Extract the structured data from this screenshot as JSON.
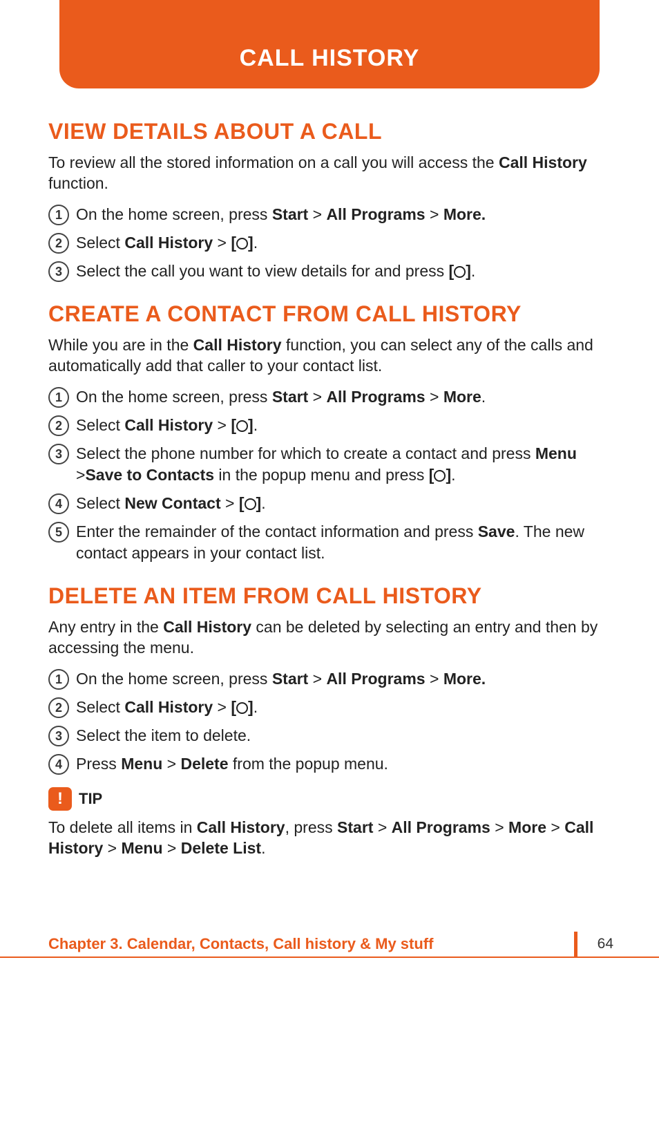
{
  "header": {
    "title": "CALL HISTORY"
  },
  "sections": {
    "view": {
      "heading": "VIEW DETAILS ABOUT A CALL",
      "intro_pre": "To review all the stored information on a call you will access the ",
      "intro_bold": "Call History",
      "intro_post": " function.",
      "s1_a": "On the home screen, press ",
      "s1_b": "Start",
      "s1_c": " > ",
      "s1_d": "All Programs",
      "s1_e": " > ",
      "s1_f": "More.",
      "s2_a": "Select ",
      "s2_b": "Call History",
      "s2_c": " > ",
      "s2_lb": "[",
      "s2_rb": "]",
      "s2_d": ".",
      "s3_a": "Select the call you want to view details for and press ",
      "s3_lb": "[",
      "s3_rb": "]",
      "s3_b": "."
    },
    "create": {
      "heading": "CREATE A CONTACT FROM CALL HISTORY",
      "intro_a": "While you are in the ",
      "intro_b": "Call History",
      "intro_c": " function, you can select any of the calls and automatically add that caller to your contact list.",
      "s1_a": "On the home screen, press ",
      "s1_b": "Start",
      "s1_c": " > ",
      "s1_d": "All Programs",
      "s1_e": " > ",
      "s1_f": "More",
      "s1_g": ".",
      "s2_a": "Select ",
      "s2_b": "Call History",
      "s2_c": " > ",
      "s2_lb": "[",
      "s2_rb": "]",
      "s2_d": ".",
      "s3_a": "Select the phone number for which to create a contact and press ",
      "s3_b": "Menu",
      "s3_c": " >",
      "s3_d": "Save to Contacts",
      "s3_e": " in the popup menu and press ",
      "s3_lb": "[",
      "s3_rb": "]",
      "s3_f": ".",
      "s4_a": "Select ",
      "s4_b": "New Contact",
      "s4_c": " > ",
      "s4_lb": "[",
      "s4_rb": "]",
      "s4_d": ".",
      "s5_a": "Enter the remainder of the contact information and press ",
      "s5_b": "Save",
      "s5_c": ". The new contact appears in your contact list."
    },
    "del": {
      "heading": "DELETE AN ITEM FROM CALL HISTORY",
      "intro_a": "Any entry in the ",
      "intro_b": "Call History",
      "intro_c": " can be deleted by selecting an entry and then by accessing the menu.",
      "s1_a": "On the home screen, press ",
      "s1_b": "Start",
      "s1_c": " > ",
      "s1_d": "All Programs",
      "s1_e": " > ",
      "s1_f": "More.",
      "s2_a": "Select ",
      "s2_b": "Call History",
      "s2_c": " > ",
      "s2_lb": "[",
      "s2_rb": "]",
      "s2_d": ".",
      "s3_a": "Select the item to delete.",
      "s4_a": "Press ",
      "s4_b": "Menu",
      "s4_c": " > ",
      "s4_d": "Delete",
      "s4_e": " from the popup menu."
    }
  },
  "tip": {
    "label": "TIP",
    "t1": "To delete all items in ",
    "t2": "Call History",
    "t3": ", press ",
    "t4": "Start",
    "t5": " > ",
    "t6": "All Programs",
    "t7": " > ",
    "t8": "More",
    "t9": " > ",
    "t10": "Call History",
    "t11": " > ",
    "t12": "Menu",
    "t13": " > ",
    "t14": "Delete List",
    "t15": "."
  },
  "footer": {
    "chapter": "Chapter 3. Calendar, Contacts, Call history & My stuff",
    "page": "64"
  },
  "nums": {
    "n1": "1",
    "n2": "2",
    "n3": "3",
    "n4": "4",
    "n5": "5"
  },
  "icon": {
    "bang": "!"
  }
}
